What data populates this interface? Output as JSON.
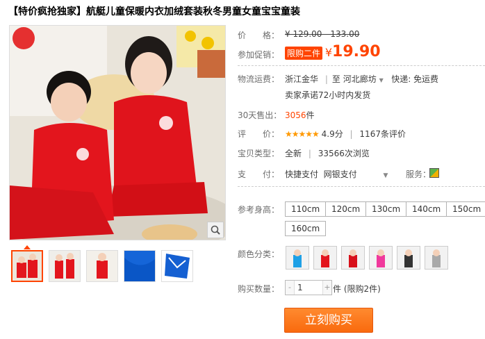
{
  "title": "【特价疯抢独家】航艇儿童保暖内衣加绒套装秋冬男童女童宝宝童装",
  "price": {
    "label": "价　　格：",
    "original": "¥ 129.00 - 133.00"
  },
  "promo": {
    "label": "参加促销：",
    "badge": "限购二件",
    "yen": "¥",
    "amount": "19.90"
  },
  "shipping": {
    "label": "物流运费：",
    "from": "浙江金华",
    "to_prefix": "至",
    "to": "河北廊坊",
    "fee": "快递: 免运费",
    "note": "卖家承诺72小时内发货"
  },
  "sales": {
    "label": "30天售出：",
    "count": "3056",
    "unit": "件"
  },
  "rating": {
    "label": "评　　价：",
    "stars": "★★★★★",
    "score": "4.9分",
    "reviews": "1167条评价"
  },
  "item_type": {
    "label": "宝贝类型：",
    "condition": "全新",
    "views": "33566次浏览"
  },
  "payment": {
    "label": "支　　付：",
    "method1": "快捷支付",
    "method2": "网银支付",
    "service_label": "服务："
  },
  "sizes": {
    "label": "参考身高：",
    "options": [
      "110cm",
      "120cm",
      "130cm",
      "140cm",
      "150cm",
      "160cm"
    ]
  },
  "colors": {
    "label": "颜色分类：",
    "options": [
      "blue",
      "red-girl",
      "red-boy",
      "pink",
      "black",
      "gray"
    ]
  },
  "quantity": {
    "label": "购买数量：",
    "value": "1",
    "minus": "-",
    "plus": "+",
    "note": "件 (限购2件)"
  },
  "buy_button": "立刻购买",
  "icons": {
    "zoom": "magnifier-icon",
    "sep": "|",
    "pipe": "|"
  },
  "theme": {
    "accent": "#ff4400",
    "star": "#ff9900"
  }
}
